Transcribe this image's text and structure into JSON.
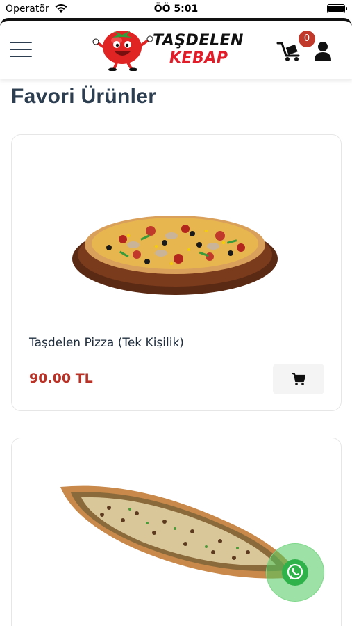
{
  "status_bar": {
    "carrier": "Operatör",
    "time": "ÖÖ 5:01"
  },
  "header": {
    "logo_line_1": "TAŞDELEN",
    "logo_line_2": "KEBAP",
    "cart_count": "0",
    "icons": [
      "menu-icon",
      "cart-icon",
      "user-icon"
    ]
  },
  "page": {
    "title": "Favori Ürünler"
  },
  "products": [
    {
      "name": "Taşdelen Pizza (Tek Kişilik)",
      "price": "90.00 TL",
      "image": "pizza-image"
    },
    {
      "name": "",
      "price": "",
      "image": "pide-image"
    }
  ],
  "floating": {
    "icon": "whatsapp-icon",
    "color": "#2fb24a"
  },
  "colors": {
    "accent": "#b83227",
    "badge": "#c0392b",
    "title": "#2c3e50"
  }
}
